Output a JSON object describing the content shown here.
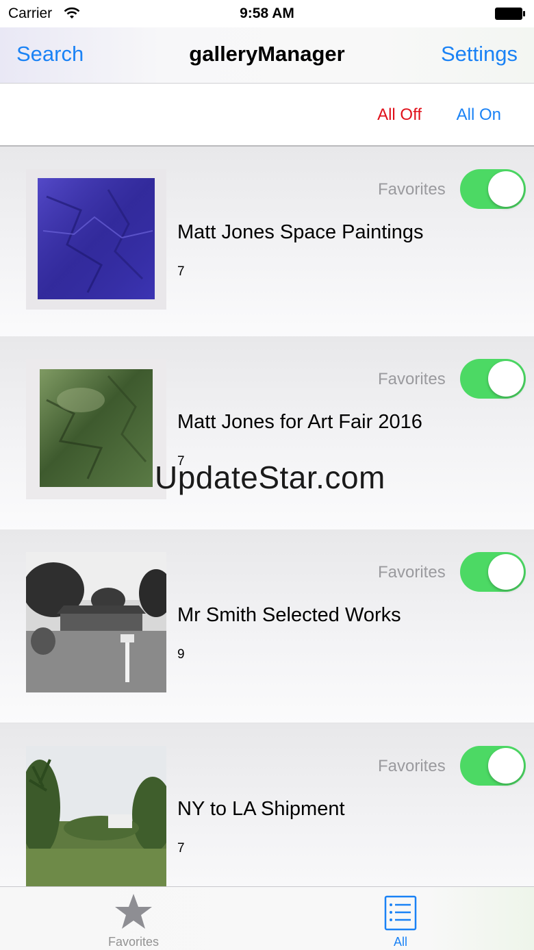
{
  "status_bar": {
    "carrier": "Carrier",
    "time": "9:58 AM"
  },
  "nav": {
    "left_button": "Search",
    "title": "galleryManager",
    "right_button": "Settings"
  },
  "toolbar": {
    "all_off": "All Off",
    "all_on": "All On"
  },
  "colors": {
    "accent": "#1a82f5",
    "danger": "#e0101a",
    "toggle_on": "#4cd964",
    "muted": "#9a9a9e"
  },
  "galleries": [
    {
      "title": "Matt Jones Space Paintings",
      "count": "7",
      "favorites_label": "Favorites",
      "favorite": true,
      "thumb": "blue-painting"
    },
    {
      "title": "Matt Jones for Art Fair 2016",
      "count": "7",
      "favorites_label": "Favorites",
      "favorite": true,
      "thumb": "green-painting"
    },
    {
      "title": "Mr Smith Selected Works",
      "count": "9",
      "favorites_label": "Favorites",
      "favorite": true,
      "thumb": "house-photo"
    },
    {
      "title": "NY to LA Shipment",
      "count": "7",
      "favorites_label": "Favorites",
      "favorite": true,
      "thumb": "field-photo"
    }
  ],
  "watermark": "UpdateStar.com",
  "tabs": [
    {
      "label": "Favorites",
      "icon": "star-icon",
      "selected": false
    },
    {
      "label": "All",
      "icon": "list-icon",
      "selected": true
    }
  ]
}
